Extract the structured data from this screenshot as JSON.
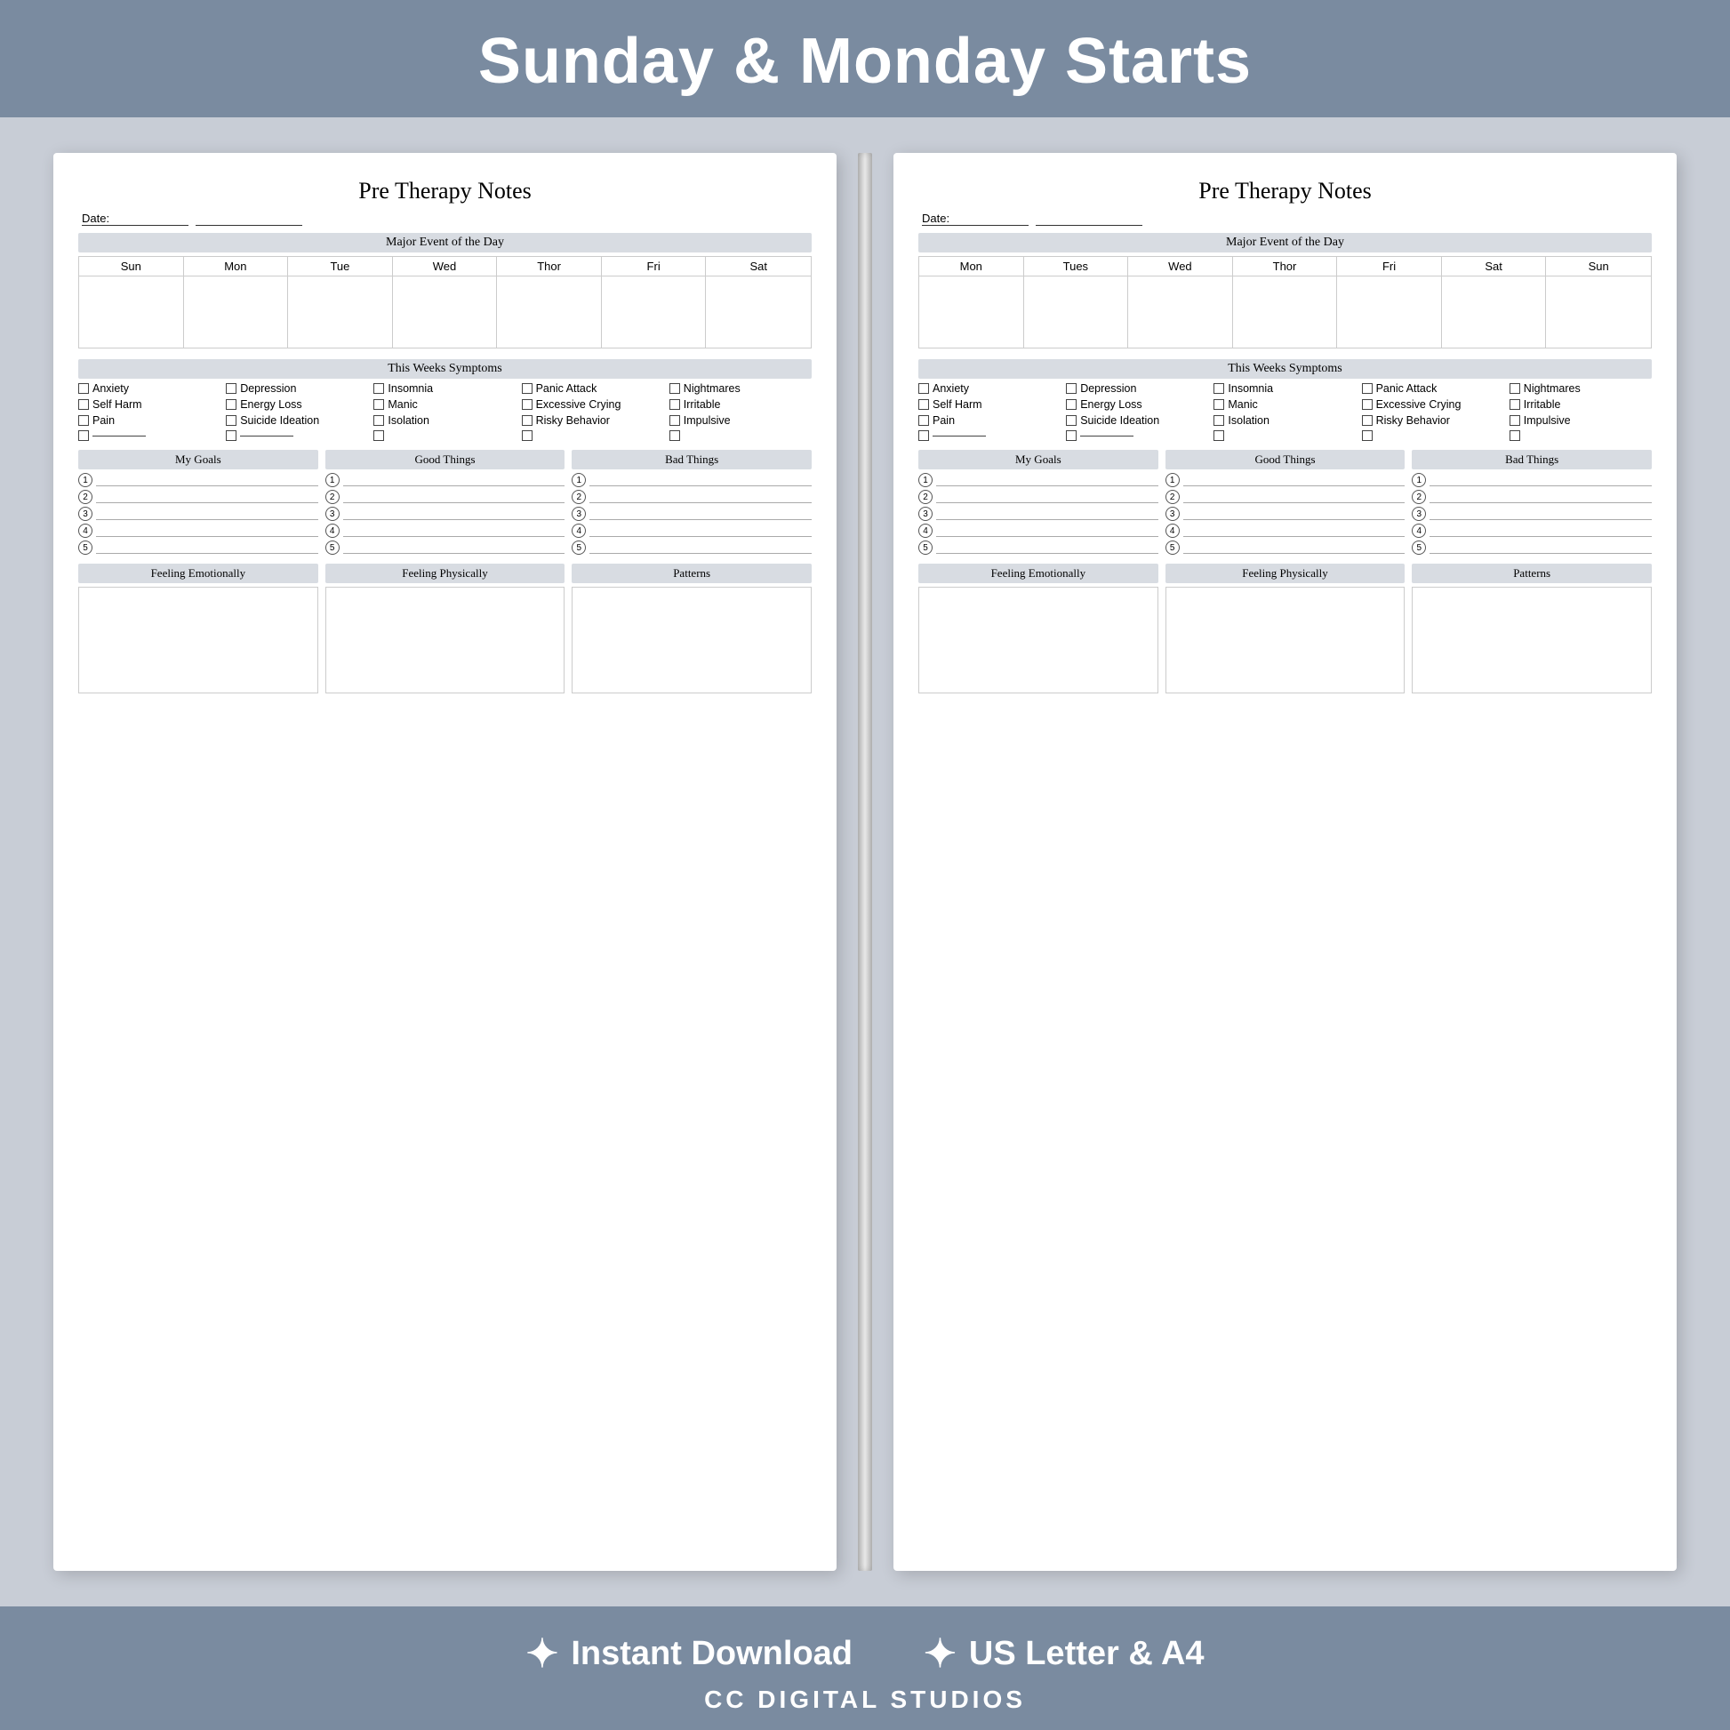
{
  "header": {
    "title": "Sunday & Monday Starts"
  },
  "page_left": {
    "title": "Pre Therapy Notes",
    "date_label": "Date:",
    "major_event_label": "Major Event of the Day",
    "days_sunday_start": [
      "Sun",
      "Mon",
      "Tue",
      "Wed",
      "Thor",
      "Fri",
      "Sat"
    ],
    "symptoms_label": "This Weeks Symptoms",
    "symptoms": [
      "Anxiety",
      "Depression",
      "Insomnia",
      "Panic Attack",
      "Nightmares",
      "Self Harm",
      "Energy Loss",
      "Manic",
      "Excessive Crying",
      "Irritable",
      "Pain",
      "Suicide Ideation",
      "Isolation",
      "Risky Behavior",
      "Impulsive"
    ],
    "goals_label": "My Goals",
    "good_label": "Good Things",
    "bad_label": "Bad Things",
    "feeling_emotional_label": "Feeling Emotionally",
    "feeling_physical_label": "Feeling Physically",
    "patterns_label": "Patterns",
    "list_count": 5
  },
  "page_right": {
    "title": "Pre Therapy Notes",
    "date_label": "Date:",
    "major_event_label": "Major Event of the Day",
    "days_monday_start": [
      "Mon",
      "Tues",
      "Wed",
      "Thor",
      "Fri",
      "Sat",
      "Sun"
    ],
    "symptoms_label": "This Weeks Symptoms",
    "symptoms": [
      "Anxiety",
      "Depression",
      "Insomnia",
      "Panic Attack",
      "Nightmares",
      "Self Harm",
      "Energy Loss",
      "Manic",
      "Excessive Crying",
      "Irritable",
      "Pain",
      "Suicide Ideation",
      "Isolation",
      "Risky Behavior",
      "Impulsive"
    ],
    "goals_label": "My Goals",
    "good_label": "Good Things",
    "bad_label": "Bad Things",
    "feeling_emotional_label": "Feeling Emotionally",
    "feeling_physical_label": "Feeling Physically",
    "patterns_label": "Patterns",
    "list_count": 5
  },
  "footer": {
    "badge1": "Instant Download",
    "badge2": "US Letter & A4",
    "brand": "CC DIGITAL STUDIOS"
  }
}
